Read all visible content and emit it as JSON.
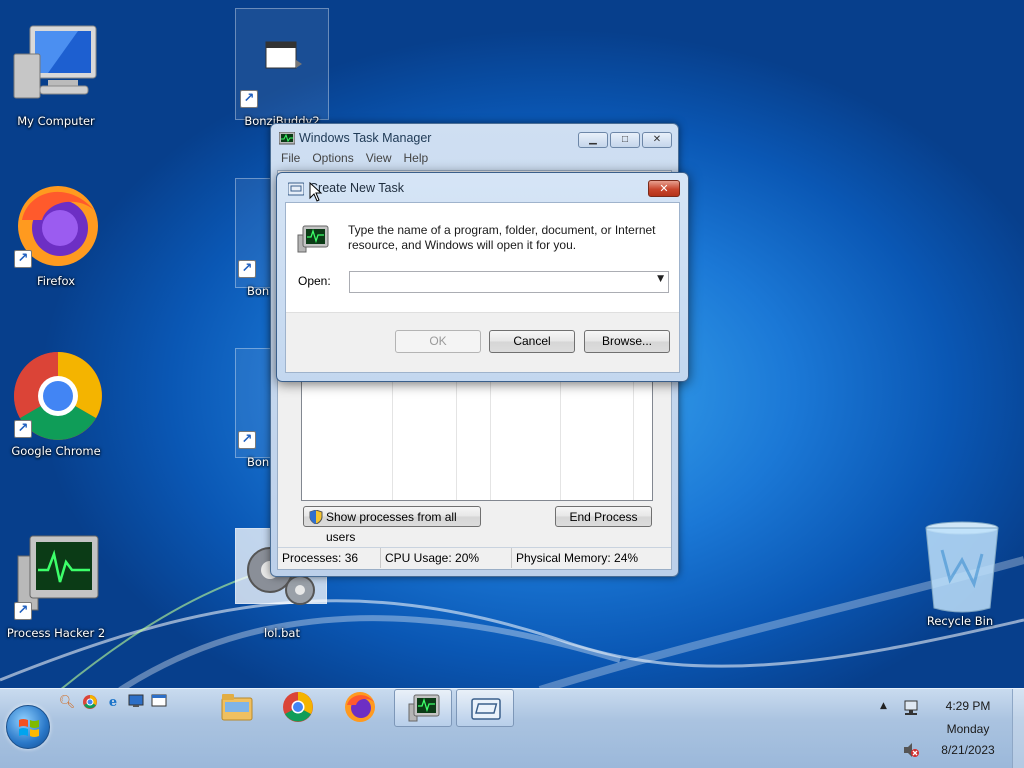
{
  "desktop": {
    "icons": [
      {
        "id": "my-computer",
        "label": "My Computer"
      },
      {
        "id": "bonzibuddy2",
        "label": "BonziBuddy2"
      },
      {
        "id": "firefox",
        "label": "Firefox"
      },
      {
        "id": "bonzi-a",
        "label": "Bon"
      },
      {
        "id": "google-chrome",
        "label": "Google Chrome"
      },
      {
        "id": "bonzi-b",
        "label": "Bon"
      },
      {
        "id": "process-hacker",
        "label": "Process Hacker 2"
      },
      {
        "id": "lol-bat",
        "label": "lol.bat"
      },
      {
        "id": "recycle-bin",
        "label": "Recycle Bin"
      }
    ]
  },
  "task_manager": {
    "title": "Windows Task Manager",
    "menu": [
      "File",
      "Options",
      "View",
      "Help"
    ],
    "show_all_label": "Show processes from all users",
    "end_process_label": "End Process",
    "status": {
      "processes": "Processes: 36",
      "cpu": "CPU Usage: 20%",
      "memory": "Physical Memory: 24%"
    }
  },
  "dialog": {
    "title": "Create New Task",
    "description": "Type the name of a program, folder, document, or Internet resource, and Windows will open it for you.",
    "open_label": "Open:",
    "open_value": "",
    "ok_label": "OK",
    "cancel_label": "Cancel",
    "browse_label": "Browse..."
  },
  "taskbar": {
    "quick_launch": [
      "search-icon",
      "chrome-icon",
      "internet-explorer-icon",
      "desktop-icon",
      "window-icon"
    ],
    "pinned": [
      "file-explorer-icon",
      "chrome-icon",
      "firefox-icon",
      "task-manager-icon",
      "run-dialog-icon"
    ],
    "clock": {
      "time": "4:29 PM",
      "day": "Monday",
      "date": "8/21/2023"
    }
  },
  "colors": {
    "accent": "#1b78d6",
    "close_red": "#c8462d"
  }
}
